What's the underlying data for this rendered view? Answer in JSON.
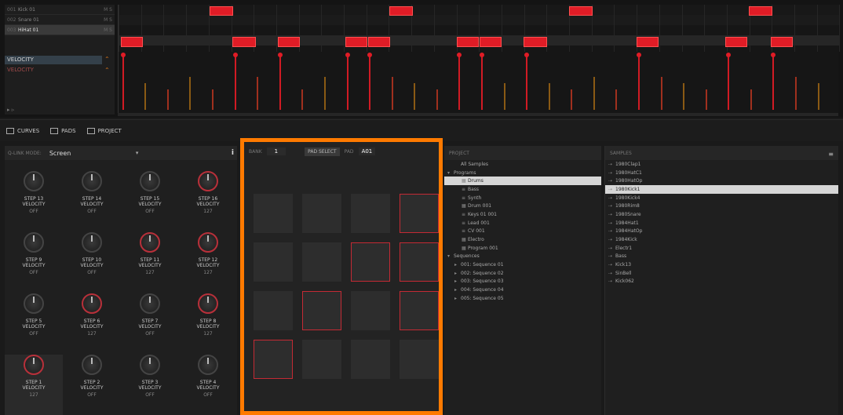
{
  "sequencer": {
    "tracks": [
      {
        "num": "001",
        "name": "Kick 01",
        "ctl": "M S"
      },
      {
        "num": "002",
        "name": "Snare 01",
        "ctl": "M S"
      },
      {
        "num": "003",
        "name": "HiHat 01",
        "ctl": "M S"
      },
      {
        "num": "",
        "name": "",
        "ctl": ""
      }
    ],
    "lane_primary": "VELOCITY",
    "lane_secondary": "VELOCITY",
    "footer": "▸ ▹"
  },
  "tabs": [
    {
      "label": "CURVES",
      "icon": "curves-icon"
    },
    {
      "label": "PADS",
      "icon": "pads-icon"
    },
    {
      "label": "PROJECT",
      "icon": "project-icon"
    }
  ],
  "knob_panel": {
    "mode_label": "Q-LINK MODE:",
    "mode_value": "Screen",
    "knobs": [
      {
        "label": "STEP 13\nVELOCITY",
        "value": "OFF",
        "red": false,
        "hl": false
      },
      {
        "label": "STEP 14\nVELOCITY",
        "value": "OFF",
        "red": false,
        "hl": false
      },
      {
        "label": "STEP 15\nVELOCITY",
        "value": "OFF",
        "red": false,
        "hl": false
      },
      {
        "label": "STEP 16\nVELOCITY",
        "value": "127",
        "red": true,
        "hl": false
      },
      {
        "label": "STEP 9\nVELOCITY",
        "value": "OFF",
        "red": false,
        "hl": false
      },
      {
        "label": "STEP 10\nVELOCITY",
        "value": "OFF",
        "red": false,
        "hl": false
      },
      {
        "label": "STEP 11\nVELOCITY",
        "value": "127",
        "red": true,
        "hl": false
      },
      {
        "label": "STEP 12\nVELOCITY",
        "value": "127",
        "red": true,
        "hl": false
      },
      {
        "label": "STEP 5\nVELOCITY",
        "value": "OFF",
        "red": false,
        "hl": false
      },
      {
        "label": "STEP 6\nVELOCITY",
        "value": "127",
        "red": true,
        "hl": false
      },
      {
        "label": "STEP 7\nVELOCITY",
        "value": "OFF",
        "red": false,
        "hl": false
      },
      {
        "label": "STEP 8\nVELOCITY",
        "value": "127",
        "red": true,
        "hl": false
      },
      {
        "label": "STEP 1\nVELOCITY",
        "value": "127",
        "red": true,
        "hl": true
      },
      {
        "label": "STEP 2\nVELOCITY",
        "value": "OFF",
        "red": false,
        "hl": false
      },
      {
        "label": "STEP 3\nVELOCITY",
        "value": "OFF",
        "red": false,
        "hl": false
      },
      {
        "label": "STEP 4\nVELOCITY",
        "value": "OFF",
        "red": false,
        "hl": false
      }
    ]
  },
  "pad_panel": {
    "bank_label": "BANK",
    "bank_value": "1",
    "pad_select_label": "PAD SELECT",
    "pad_label": "PAD",
    "pad_value": "A01",
    "pads_on": [
      false,
      false,
      false,
      true,
      false,
      false,
      true,
      true,
      false,
      true,
      false,
      true,
      true,
      false,
      false,
      false
    ]
  },
  "project": {
    "header": "PROJECT",
    "rows": [
      {
        "indent": 1,
        "icon": "",
        "text": "All Samples",
        "sel": false
      },
      {
        "indent": 0,
        "icon": "▾",
        "text": "Programs",
        "sel": false
      },
      {
        "indent": 2,
        "icon": "▦",
        "text": "Drums",
        "sel": true
      },
      {
        "indent": 2,
        "icon": "≡",
        "text": "Bass",
        "sel": false
      },
      {
        "indent": 2,
        "icon": "≡",
        "text": "Synth",
        "sel": false
      },
      {
        "indent": 2,
        "icon": "▦",
        "text": "Drum 001",
        "sel": false
      },
      {
        "indent": 2,
        "icon": "≡",
        "text": "Keys 01 001",
        "sel": false
      },
      {
        "indent": 2,
        "icon": "≡",
        "text": "Lead 001",
        "sel": false
      },
      {
        "indent": 2,
        "icon": "≡",
        "text": "CV 001",
        "sel": false
      },
      {
        "indent": 2,
        "icon": "▦",
        "text": "Electro",
        "sel": false
      },
      {
        "indent": 2,
        "icon": "▦",
        "text": "Program 001",
        "sel": false
      },
      {
        "indent": 0,
        "icon": "▾",
        "text": "Sequences",
        "sel": false
      },
      {
        "indent": 1,
        "icon": "▸",
        "text": "001: Sequence 01",
        "sel": false
      },
      {
        "indent": 1,
        "icon": "▸",
        "text": "002: Sequence 02",
        "sel": false
      },
      {
        "indent": 1,
        "icon": "▸",
        "text": "003: Sequence 03",
        "sel": false
      },
      {
        "indent": 1,
        "icon": "▸",
        "text": "004: Sequence 04",
        "sel": false
      },
      {
        "indent": 1,
        "icon": "▸",
        "text": "005: Sequence 05",
        "sel": false
      }
    ]
  },
  "samples": {
    "header": "SAMPLES",
    "menu": "≡",
    "rows": [
      {
        "text": "1980Clap1",
        "sel": false
      },
      {
        "text": "1980HatC1",
        "sel": false
      },
      {
        "text": "1980HatOp",
        "sel": false
      },
      {
        "text": "1980Kick1",
        "sel": true
      },
      {
        "text": "1980Kick4",
        "sel": false
      },
      {
        "text": "1980Rim8",
        "sel": false
      },
      {
        "text": "1980Snare",
        "sel": false
      },
      {
        "text": "1984Hat1",
        "sel": false
      },
      {
        "text": "1984HatOp",
        "sel": false
      },
      {
        "text": "1984Kick",
        "sel": false
      },
      {
        "text": "Electr1",
        "sel": false
      },
      {
        "text": "Bass",
        "sel": false
      },
      {
        "text": "Kick13",
        "sel": false
      },
      {
        "text": "SinBell",
        "sel": false
      },
      {
        "text": "Kick062",
        "sel": false
      }
    ]
  }
}
